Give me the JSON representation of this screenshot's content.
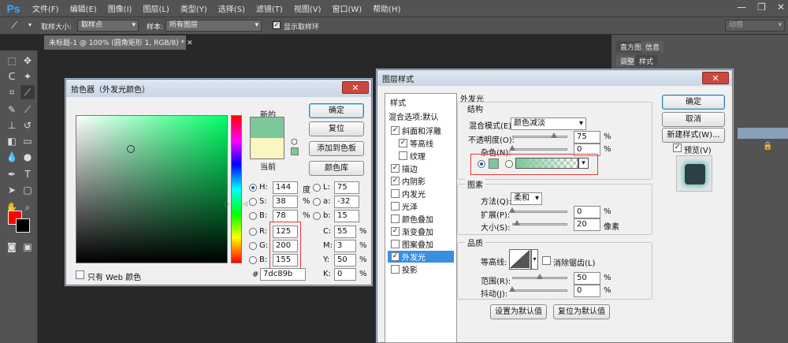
{
  "app": {
    "logo": "Ps",
    "menu": [
      "文件(F)",
      "编辑(E)",
      "图像(I)",
      "图层(L)",
      "类型(Y)",
      "选择(S)",
      "滤镜(T)",
      "视图(V)",
      "窗口(W)",
      "帮助(H)"
    ],
    "window_controls": [
      "—",
      "❐",
      "✕"
    ]
  },
  "options_bar": {
    "sample_size_label": "取样大小:",
    "sample_size_value": "取样点",
    "sample_label": "样本:",
    "sample_value": "所有图层",
    "show_ring_label": "显示取样环",
    "workspace": "动感"
  },
  "document": {
    "tab_title": "未标题-1 @ 100% (圆角矩形 1, RGB/8) *"
  },
  "right_panel": {
    "tabs_top": [
      "直方图",
      "信息"
    ],
    "tabs_second": [
      "调整",
      "样式"
    ]
  },
  "color_picker": {
    "title": "拾色器（外发光颜色）",
    "new_label": "新的",
    "current_label": "当前",
    "new_color": "#7dc89b",
    "current_color": "#fbf5bf",
    "buttons": {
      "ok": "确定",
      "reset": "复位",
      "add_swatch": "添加到色板",
      "libraries": "颜色库"
    },
    "hsb": [
      {
        "label": "H:",
        "value": "144",
        "unit": "度"
      },
      {
        "label": "S:",
        "value": "38",
        "unit": "%"
      },
      {
        "label": "B:",
        "value": "78",
        "unit": "%"
      }
    ],
    "rgb": [
      {
        "label": "R:",
        "value": "125"
      },
      {
        "label": "G:",
        "value": "200"
      },
      {
        "label": "B:",
        "value": "155"
      }
    ],
    "lab": [
      {
        "label": "L:",
        "value": "75"
      },
      {
        "label": "a:",
        "value": "-32"
      },
      {
        "label": "b:",
        "value": "15"
      }
    ],
    "cmyk": [
      {
        "label": "C:",
        "value": "55",
        "unit": "%"
      },
      {
        "label": "M:",
        "value": "3",
        "unit": "%"
      },
      {
        "label": "Y:",
        "value": "50",
        "unit": "%"
      },
      {
        "label": "K:",
        "value": "0",
        "unit": "%"
      }
    ],
    "hex_label": "#",
    "hex_value": "7dc89b",
    "web_only_label": "只有 Web 颜色"
  },
  "layer_style": {
    "title": "图层样式",
    "styles_header": "样式",
    "blend_options": "混合选项:默认",
    "styles": [
      {
        "label": "斜面和浮雕",
        "checked": "✓",
        "indent": "0"
      },
      {
        "label": "等高线",
        "checked": "✓",
        "indent": "1"
      },
      {
        "label": "纹理",
        "checked": "",
        "indent": "1"
      },
      {
        "label": "描边",
        "checked": "✓",
        "indent": "0"
      },
      {
        "label": "内阴影",
        "checked": "✓",
        "indent": "0"
      },
      {
        "label": "内发光",
        "checked": "",
        "indent": "0"
      },
      {
        "label": "光泽",
        "checked": "",
        "indent": "0"
      },
      {
        "label": "颜色叠加",
        "checked": "",
        "indent": "0"
      },
      {
        "label": "渐变叠加",
        "checked": "✓",
        "indent": "0"
      },
      {
        "label": "图案叠加",
        "checked": "",
        "indent": "0"
      },
      {
        "label": "外发光",
        "checked": "✓",
        "indent": "0"
      },
      {
        "label": "投影",
        "checked": "",
        "indent": "0"
      }
    ],
    "section_title": "外发光",
    "structure": {
      "title": "结构",
      "blend_mode_label": "混合模式(E):",
      "blend_mode_value": "颜色减淡",
      "opacity_label": "不透明度(O):",
      "opacity_value": "75",
      "opacity_fraction": 0.75,
      "noise_label": "杂色(N):",
      "noise_value": "0",
      "noise_fraction": 0.0,
      "pct": "%",
      "swatch_color": "#7dc89b"
    },
    "elements": {
      "title": "图素",
      "method_label": "方法(Q):",
      "method_value": "柔和",
      "spread_label": "扩展(P):",
      "spread_value": "0",
      "spread_fraction": 0.0,
      "size_label": "大小(S):",
      "size_value": "20",
      "size_fraction": 0.08,
      "pct": "%",
      "px": "像素"
    },
    "quality": {
      "title": "品质",
      "contour_label": "等高线:",
      "antialias_label": "消除锯齿(L)",
      "range_label": "范围(R):",
      "range_value": "50",
      "range_fraction": 0.5,
      "jitter_label": "抖动(J):",
      "jitter_value": "0",
      "jitter_fraction": 0.0,
      "pct": "%"
    },
    "buttons": {
      "ok": "确定",
      "cancel": "取消",
      "new_style": "新建样式(W)...",
      "preview": "预览(V)",
      "set_default": "设置为默认值",
      "reset_default": "复位为默认值"
    }
  }
}
